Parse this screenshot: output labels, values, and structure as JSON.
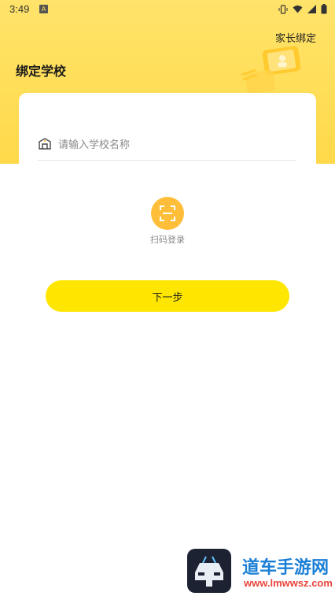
{
  "status_bar": {
    "time": "3:49",
    "notification_icon": "A"
  },
  "header": {
    "parent_bind": "家长绑定",
    "title": "绑定学校"
  },
  "form": {
    "school_placeholder": "请输入学校名称",
    "school_value": ""
  },
  "scan": {
    "label": "扫码登录"
  },
  "actions": {
    "next_label": "下一步"
  },
  "watermark": {
    "title": "道车手游网",
    "url": "www.lmwwsz.com"
  },
  "colors": {
    "hero": "#ffd94a",
    "scan_circle": "#ffbe3a",
    "primary_button": "#ffe600",
    "watermark_title": "#1a7fd6",
    "watermark_url": "#e8453c"
  }
}
